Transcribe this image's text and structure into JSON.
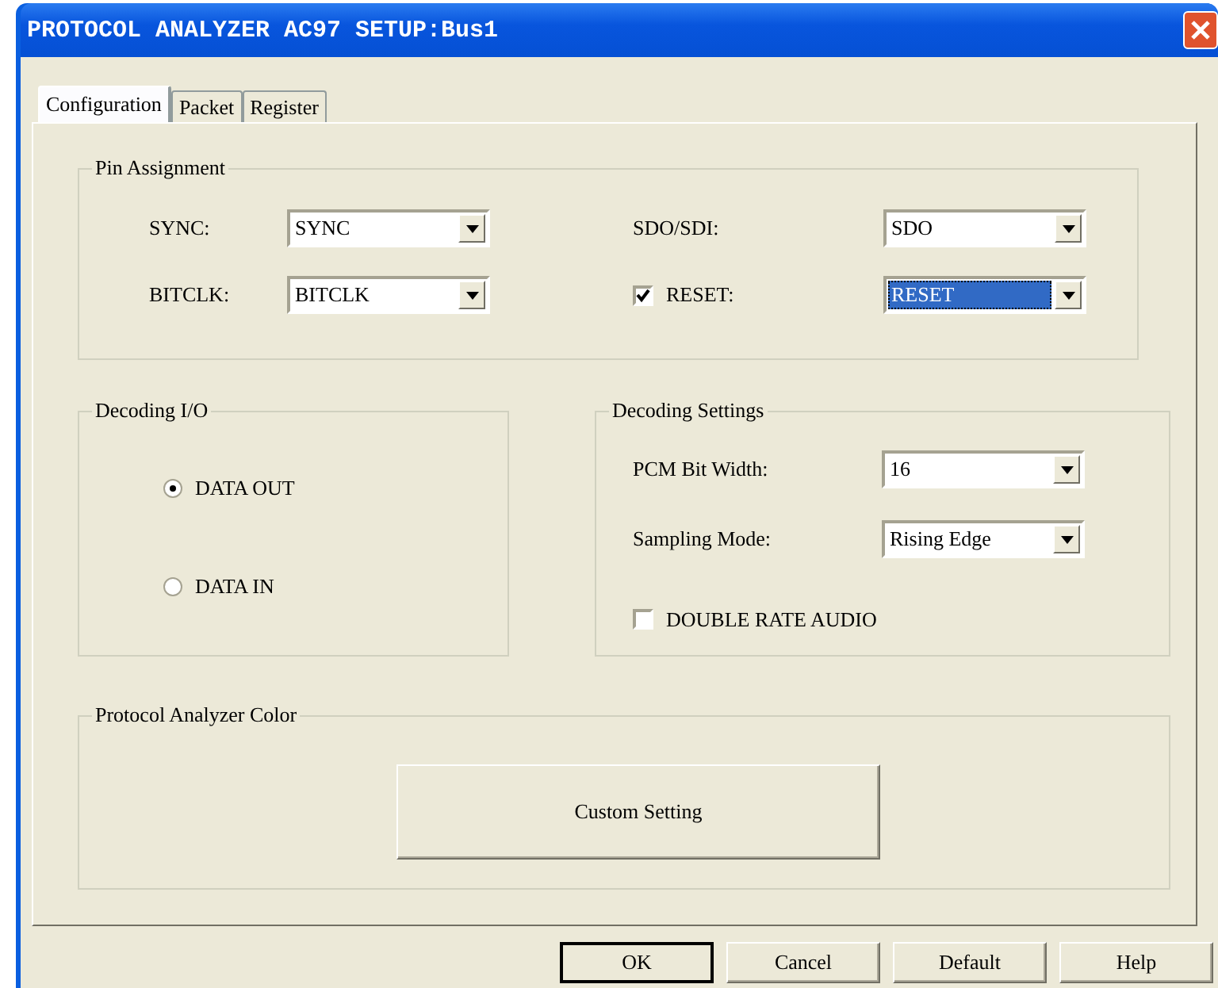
{
  "window": {
    "title": "PROTOCOL ANALYZER AC97 SETUP:Bus1"
  },
  "tabs": [
    {
      "label": "Configuration",
      "selected": true
    },
    {
      "label": "Packet",
      "selected": false
    },
    {
      "label": "Register",
      "selected": false
    }
  ],
  "pin_assignment": {
    "title": "Pin Assignment",
    "fields": [
      {
        "kind": "label",
        "label": "SYNC:",
        "value": "SYNC",
        "focused": false
      },
      {
        "kind": "label",
        "label": "SDO/SDI:",
        "value": "SDO",
        "focused": false
      },
      {
        "kind": "label",
        "label": "BITCLK:",
        "value": "BITCLK",
        "focused": false
      },
      {
        "kind": "checkbox",
        "label": "RESET:",
        "checked": true,
        "value": "RESET",
        "focused": true
      }
    ]
  },
  "decoding_io": {
    "title": "Decoding I/O",
    "options": [
      {
        "label": "DATA OUT",
        "selected": true
      },
      {
        "label": "DATA IN",
        "selected": false
      }
    ]
  },
  "decoding_settings": {
    "title": "Decoding Settings",
    "fields": [
      {
        "label": "PCM Bit Width:",
        "value": "16"
      },
      {
        "label": "Sampling Mode:",
        "value": "Rising Edge"
      }
    ],
    "checkbox": {
      "label": "DOUBLE RATE AUDIO",
      "checked": false
    }
  },
  "analyzer_color": {
    "title": "Protocol Analyzer Color",
    "button": "Custom Setting"
  },
  "buttons": [
    {
      "label": "OK",
      "default": true
    },
    {
      "label": "Cancel",
      "default": false
    },
    {
      "label": "Default",
      "default": false
    },
    {
      "label": "Help",
      "default": false
    }
  ]
}
